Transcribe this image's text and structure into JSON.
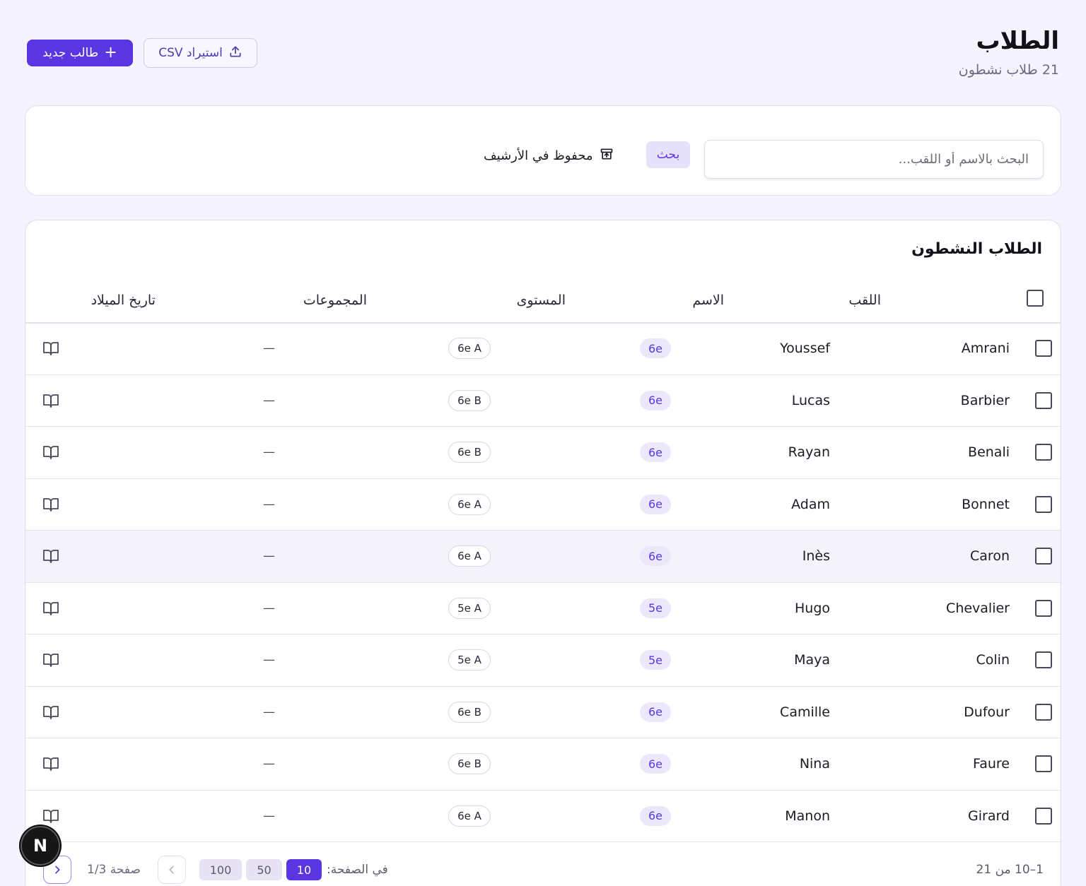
{
  "header": {
    "title": "الطلاب",
    "subtitle": "21 طلاب نشطون",
    "new_student_label": "طالب جديد",
    "import_label": "استيراد CSV"
  },
  "filters": {
    "search_placeholder": "البحث بالاسم أو اللقب...",
    "search_button": "بحث",
    "archived_label": "محفوظ في الأرشيف"
  },
  "table": {
    "title": "الطلاب النشطون",
    "columns": {
      "last_name": "اللقب",
      "first_name": "الاسم",
      "level": "المستوى",
      "groups": "المجموعات",
      "birth_date": "تاريخ الميلاد"
    },
    "rows": [
      {
        "last": "Amrani",
        "first": "Youssef",
        "level": "6e",
        "class": "6e A",
        "groups": "—"
      },
      {
        "last": "Barbier",
        "first": "Lucas",
        "level": "6e",
        "class": "6e B",
        "groups": "—"
      },
      {
        "last": "Benali",
        "first": "Rayan",
        "level": "6e",
        "class": "6e B",
        "groups": "—"
      },
      {
        "last": "Bonnet",
        "first": "Adam",
        "level": "6e",
        "class": "6e A",
        "groups": "—"
      },
      {
        "last": "Caron",
        "first": "Inès",
        "level": "6e",
        "class": "6e A",
        "groups": "—"
      },
      {
        "last": "Chevalier",
        "first": "Hugo",
        "level": "5e",
        "class": "5e A",
        "groups": "—"
      },
      {
        "last": "Colin",
        "first": "Maya",
        "level": "5e",
        "class": "5e A",
        "groups": "—"
      },
      {
        "last": "Dufour",
        "first": "Camille",
        "level": "6e",
        "class": "6e B",
        "groups": "—"
      },
      {
        "last": "Faure",
        "first": "Nina",
        "level": "6e",
        "class": "6e B",
        "groups": "—"
      },
      {
        "last": "Girard",
        "first": "Manon",
        "level": "6e",
        "class": "6e A",
        "groups": "—"
      }
    ]
  },
  "pagination": {
    "range_text": "1–10 من 21",
    "per_page_label": "في الصفحة:",
    "per_page_options": [
      "10",
      "50",
      "100"
    ],
    "per_page_selected": "10",
    "page_info": "صفحة 1/3"
  },
  "badge": {
    "letter": "N"
  },
  "colors": {
    "accent": "#5a35e2",
    "background": "#f5f3fe",
    "level_badge_bg": "#ece8fc"
  }
}
